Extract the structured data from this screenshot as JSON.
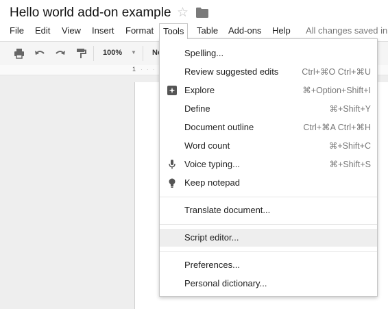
{
  "document": {
    "title": "Hello world add-on example"
  },
  "icons": {
    "star": "star-icon",
    "folder": "folder-icon"
  },
  "menubar": {
    "items": [
      "File",
      "Edit",
      "View",
      "Insert",
      "Format",
      "Tools",
      "Table",
      "Add-ons",
      "Help"
    ],
    "active": "Tools",
    "status": "All changes saved in"
  },
  "toolbar": {
    "zoom": "100%",
    "style_value": "No"
  },
  "ruler": {
    "mark": "1"
  },
  "tools_menu": {
    "items": [
      {
        "label": "Spelling...",
        "shortcut": "",
        "icon": ""
      },
      {
        "label": "Review suggested edits",
        "shortcut": "Ctrl+⌘O Ctrl+⌘U",
        "icon": ""
      },
      {
        "label": "Explore",
        "shortcut": "⌘+Option+Shift+I",
        "icon": "explore-icon"
      },
      {
        "label": "Define",
        "shortcut": "⌘+Shift+Y",
        "icon": ""
      },
      {
        "label": "Document outline",
        "shortcut": "Ctrl+⌘A Ctrl+⌘H",
        "icon": ""
      },
      {
        "label": "Word count",
        "shortcut": "⌘+Shift+C",
        "icon": ""
      },
      {
        "label": "Voice typing...",
        "shortcut": "⌘+Shift+S",
        "icon": "microphone-icon"
      },
      {
        "label": "Keep notepad",
        "shortcut": "",
        "icon": "lightbulb-icon"
      },
      {
        "label": "Translate document...",
        "shortcut": "",
        "icon": ""
      },
      {
        "label": "Script editor...",
        "shortcut": "",
        "icon": ""
      },
      {
        "label": "Preferences...",
        "shortcut": "",
        "icon": ""
      },
      {
        "label": "Personal dictionary...",
        "shortcut": "",
        "icon": ""
      }
    ],
    "highlighted": "Script editor..."
  },
  "colors": {
    "menu_hover": "#eeeeee",
    "shortcut_text": "#777777",
    "status_text": "#777777"
  }
}
